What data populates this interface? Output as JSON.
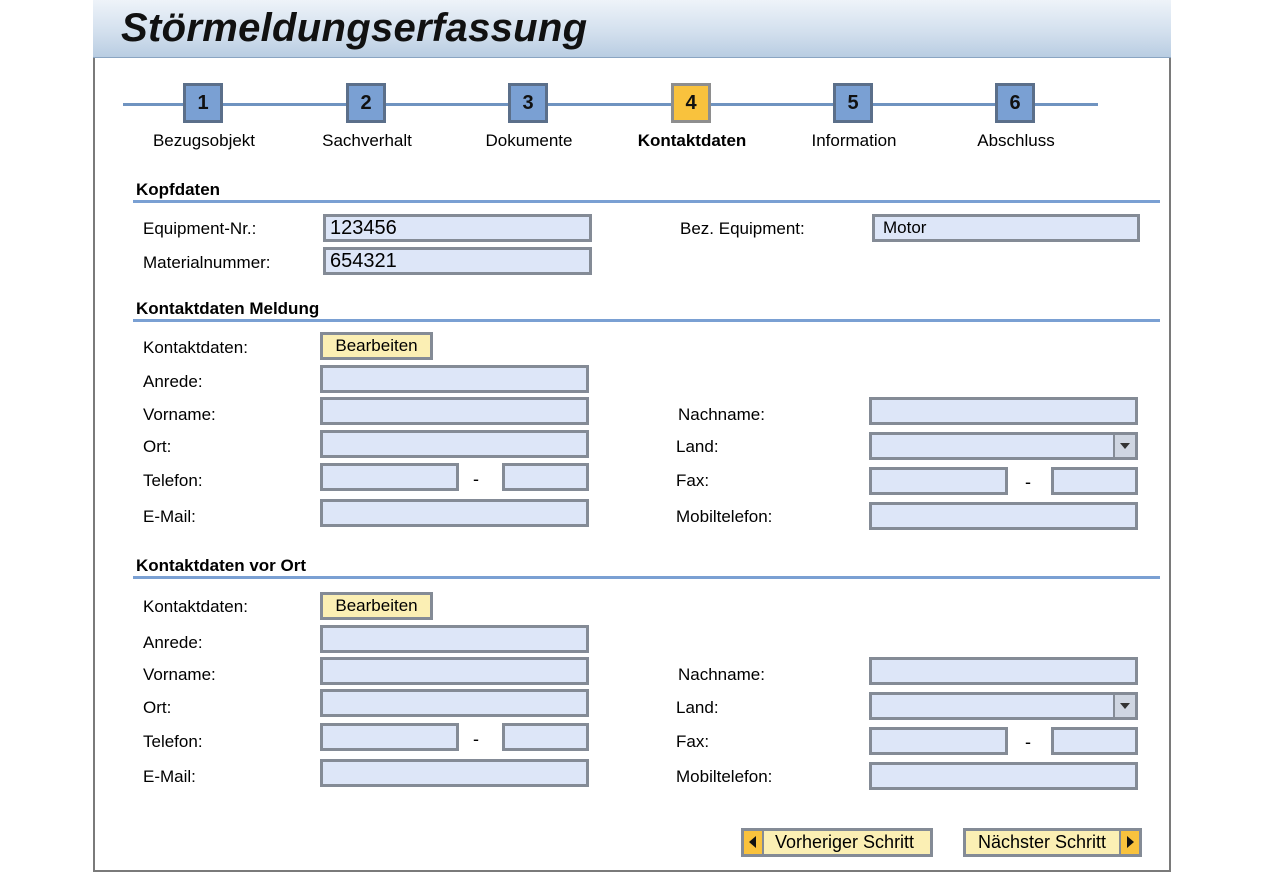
{
  "title": "Störmeldungserfassung",
  "steps": [
    {
      "number": "1",
      "label": "Bezugsobjekt"
    },
    {
      "number": "2",
      "label": "Sachverhalt"
    },
    {
      "number": "3",
      "label": "Dokumente"
    },
    {
      "number": "4",
      "label": "Kontaktdaten"
    },
    {
      "number": "5",
      "label": "Information"
    },
    {
      "number": "6",
      "label": "Abschluss"
    }
  ],
  "active_step": "4",
  "kopfdaten": {
    "heading": "Kopfdaten",
    "equipment_nr_label": "Equipment-Nr.:",
    "equipment_nr_value": "123456",
    "materialnummer_label": "Materialnummer:",
    "materialnummer_value": "654321",
    "bez_equipment_label": "Bez. Equipment:",
    "bez_equipment_value": "Motor"
  },
  "kontakt_meldung": {
    "heading": "Kontaktdaten Meldung",
    "kontaktdaten_label": "Kontaktdaten:",
    "edit_button": "Bearbeiten",
    "anrede_label": "Anrede:",
    "vorname_label": "Vorname:",
    "nachname_label": "Nachname:",
    "ort_label": "Ort:",
    "land_label": "Land:",
    "telefon_label": "Telefon:",
    "fax_label": "Fax:",
    "email_label": "E-Mail:",
    "mobil_label": "Mobiltelefon:",
    "separator": "-"
  },
  "kontakt_vor_ort": {
    "heading": "Kontaktdaten vor Ort",
    "kontaktdaten_label": "Kontaktdaten:",
    "edit_button": "Bearbeiten",
    "anrede_label": "Anrede:",
    "vorname_label": "Vorname:",
    "nachname_label": "Nachname:",
    "ort_label": "Ort:",
    "land_label": "Land:",
    "telefon_label": "Telefon:",
    "fax_label": "Fax:",
    "email_label": "E-Mail:",
    "mobil_label": "Mobiltelefon:",
    "separator": "-"
  },
  "navigation": {
    "prev_label": "Vorheriger Schritt",
    "next_label": "Nächster Schritt"
  },
  "colors": {
    "step_default": "#7aa0d3",
    "step_active": "#f9c23d",
    "field_bg": "#dde6f8",
    "button_bg": "#fbefb4",
    "rule": "#7aa0d3"
  }
}
